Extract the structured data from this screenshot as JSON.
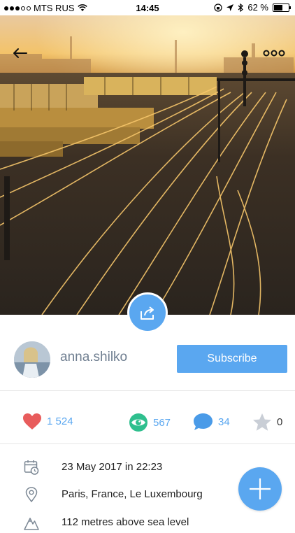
{
  "status_bar": {
    "carrier": "MTS RUS",
    "time": "14:45",
    "battery": "62 %",
    "battery_level": 0.62
  },
  "post": {
    "username": "anna.shilko",
    "subscribe_label": "Subscribe",
    "stats": {
      "likes": "1 524",
      "views": "567",
      "comments": "34",
      "favorites": "0"
    },
    "details": [
      {
        "icon": "calendar-clock-icon",
        "text": "23 May 2017 in 22:23"
      },
      {
        "icon": "location-pin-icon",
        "text": "Paris, France, Le Luxembourg"
      },
      {
        "icon": "mountain-icon",
        "text": "112 metres above sea level"
      }
    ]
  },
  "colors": {
    "accent": "#5aa7f0",
    "like": "#e85c5c",
    "views": "#2fbf8e",
    "star": "#c9ced6"
  }
}
